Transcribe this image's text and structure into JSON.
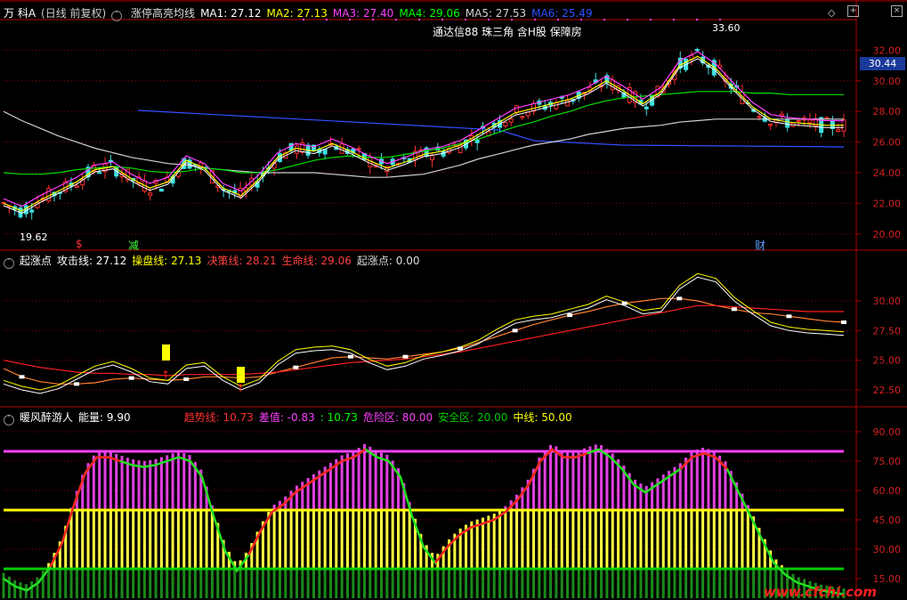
{
  "panel1": {
    "stock": "万 科A",
    "mode": "(日线 前复权)",
    "indicator": "涨停高亮均线",
    "ma": [
      {
        "label": "MA1: 27.12",
        "color": "#ffffff"
      },
      {
        "label": "MA2: 27.13",
        "color": "#ffff00"
      },
      {
        "label": "MA3: 27.40",
        "color": "#ff40ff"
      },
      {
        "label": "MA4: 29.06",
        "color": "#00ff00"
      },
      {
        "label": "MA5: 27.53",
        "color": "#d0d0d0"
      },
      {
        "label": "MA6: 25.49",
        "color": "#3050ff"
      }
    ],
    "annotation": "通达信88 珠三角 含H股 保障房",
    "high_label": "33.60",
    "low_label": "19.62",
    "price_tag": "30.44",
    "markers": [
      {
        "text": "$",
        "color": "#ff3030"
      },
      {
        "text": "减",
        "color": "#40ff40"
      },
      {
        "text": "财",
        "color": "#60a0ff"
      }
    ],
    "y_ticks": [
      "32.00",
      "30.00",
      "28.00",
      "26.00",
      "24.00",
      "22.00",
      "20.00"
    ]
  },
  "panel2": {
    "name": "起涨点",
    "items": [
      {
        "label": "攻击线: 27.12",
        "color": "#ffffff"
      },
      {
        "label": "操盘线: 27.13",
        "color": "#ffff00"
      },
      {
        "label": "决策线: 28.21",
        "color": "#ff4040"
      },
      {
        "label": "生命线: 29.06",
        "color": "#ff4040"
      },
      {
        "label": "起涨点: 0.00",
        "color": "#dddddd"
      }
    ],
    "y_ticks": [
      "30.00",
      "27.50",
      "25.00",
      "22.50"
    ]
  },
  "panel3": {
    "name": "暖风醉游人",
    "energy": "能量: 9.90",
    "items": [
      {
        "label": "趋势线: 10.73",
        "color": "#ff3030"
      },
      {
        "label": "差值: -0.83",
        "color": "#ff40ff"
      },
      {
        "label": ": 10.73",
        "color": "#00ff00"
      },
      {
        "label": "危险区: 80.00",
        "color": "#ff40ff"
      },
      {
        "label": "安全区: 20.00",
        "color": "#00cc00"
      },
      {
        "label": "中线: 50.00",
        "color": "#ffff00"
      }
    ],
    "y_ticks": [
      "90.00",
      "75.00",
      "60.00",
      "45.00",
      "30.00",
      "15.00"
    ]
  },
  "watermark": "www.cfchi.com",
  "chart_data": [
    {
      "type": "line",
      "title": "万 科A (日线 前复权) 涨停高亮均线",
      "ylim": [
        19,
        34
      ],
      "series": [
        {
          "name": "MA2",
          "values": [
            22.0,
            21.5,
            22.2,
            22.8,
            23.4,
            24.2,
            24.4,
            23.6,
            23.0,
            23.4,
            24.8,
            24.3,
            23.0,
            22.5,
            23.6,
            25.0,
            25.6,
            25.4,
            25.9,
            25.4,
            24.8,
            24.3,
            24.7,
            25.2,
            25.4,
            25.8,
            26.5,
            27.2,
            27.9,
            28.2,
            28.5,
            28.8,
            29.3,
            30.0,
            29.3,
            28.5,
            29.3,
            31.0,
            31.6,
            30.8,
            29.5,
            28.3,
            27.5,
            27.3,
            27.2,
            27.1,
            27.1
          ]
        },
        {
          "name": "MA4",
          "values": [
            24.0,
            23.9,
            23.9,
            24.0,
            24.2,
            24.3,
            24.4,
            24.3,
            24.1,
            24.0,
            24.1,
            24.3,
            24.2,
            24.0,
            24.0,
            24.2,
            24.5,
            24.8,
            25.0,
            25.1,
            25.0,
            25.0,
            25.2,
            25.4,
            25.6,
            25.9,
            26.2,
            26.6,
            27.0,
            27.3,
            27.7,
            28.0,
            28.4,
            28.7,
            28.9,
            29.0,
            29.1,
            29.2,
            29.3,
            29.3,
            29.3,
            29.2,
            29.2,
            29.1,
            29.1,
            29.1,
            29.1
          ]
        },
        {
          "name": "MA5",
          "values": [
            28.0,
            27.4,
            26.9,
            26.4,
            26.0,
            25.6,
            25.3,
            25.0,
            24.8,
            24.6,
            24.5,
            24.3,
            24.2,
            24.1,
            24.0,
            24.0,
            24.0,
            24.0,
            23.9,
            23.8,
            23.7,
            23.7,
            23.8,
            23.9,
            24.2,
            24.5,
            24.9,
            25.2,
            25.5,
            25.8,
            26.0,
            26.2,
            26.5,
            26.7,
            26.9,
            27.0,
            27.1,
            27.3,
            27.4,
            27.5,
            27.5,
            27.5,
            27.5,
            27.5,
            27.5,
            27.5,
            27.5
          ]
        }
      ]
    },
    {
      "type": "line",
      "title": "起涨点",
      "ylim": [
        21,
        33
      ],
      "series": [
        {
          "name": "决策线",
          "values": [
            24.3,
            23.6,
            23.2,
            23.0,
            23.0,
            23.1,
            23.4,
            23.5,
            23.4,
            23.3,
            23.4,
            23.6,
            23.6,
            23.5,
            23.6,
            24.0,
            24.4,
            24.8,
            25.2,
            25.3,
            25.2,
            25.1,
            25.3,
            25.5,
            25.7,
            26.0,
            26.5,
            27.0,
            27.5,
            28.0,
            28.4,
            28.8,
            29.1,
            29.5,
            29.8,
            30.0,
            30.2,
            30.2,
            30.0,
            29.6,
            29.3,
            29.0,
            28.9,
            28.7,
            28.5,
            28.3,
            28.2
          ]
        },
        {
          "name": "生命线",
          "values": [
            25.0,
            24.7,
            24.4,
            24.2,
            24.0,
            23.9,
            23.9,
            23.8,
            23.8,
            23.7,
            23.8,
            23.8,
            23.8,
            23.8,
            23.9,
            24.0,
            24.2,
            24.4,
            24.6,
            24.8,
            24.9,
            25.0,
            25.1,
            25.3,
            25.5,
            25.7,
            26.0,
            26.3,
            26.6,
            26.9,
            27.2,
            27.5,
            27.8,
            28.1,
            28.4,
            28.7,
            29.0,
            29.3,
            29.6,
            29.6,
            29.5,
            29.4,
            29.3,
            29.2,
            29.1,
            29.1,
            29.1
          ]
        },
        {
          "name": "攻击线",
          "values": [
            23.0,
            22.5,
            22.2,
            22.6,
            23.4,
            24.2,
            24.6,
            24.0,
            23.2,
            23.0,
            24.3,
            24.5,
            23.3,
            22.5,
            23.1,
            24.6,
            25.6,
            25.8,
            25.9,
            25.6,
            24.8,
            24.2,
            24.5,
            25.1,
            25.4,
            25.8,
            26.4,
            27.3,
            28.1,
            28.4,
            28.6,
            29.0,
            29.4,
            30.1,
            29.6,
            28.9,
            29.1,
            31.0,
            32.0,
            31.6,
            30.0,
            28.9,
            27.9,
            27.5,
            27.3,
            27.2,
            27.1
          ]
        }
      ]
    },
    {
      "type": "bar",
      "title": "暖风醉游人",
      "ylim": [
        5,
        95
      ],
      "values": [
        18,
        14,
        12,
        16,
        24,
        36,
        55,
        72,
        80,
        80,
        78,
        76,
        75,
        76,
        78,
        80,
        78,
        70,
        50,
        32,
        22,
        30,
        42,
        52,
        56,
        62,
        66,
        70,
        74,
        78,
        80,
        84,
        80,
        78,
        70,
        50,
        34,
        26,
        34,
        40,
        44,
        46,
        48,
        52,
        58,
        66,
        78,
        84,
        80,
        80,
        82,
        84,
        80,
        74,
        66,
        62,
        66,
        70,
        74,
        80,
        82,
        80,
        74,
        62,
        50,
        38,
        26,
        20,
        16,
        14,
        12,
        11,
        10
      ]
    }
  ]
}
